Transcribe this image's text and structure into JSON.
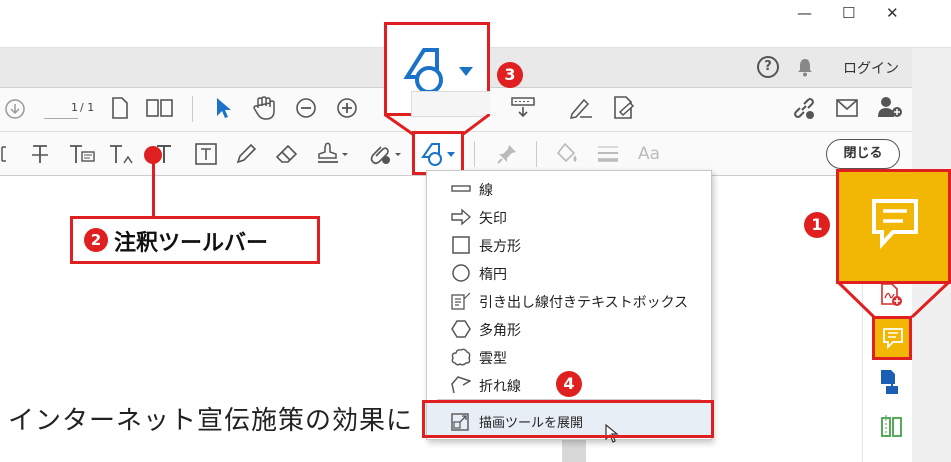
{
  "titlebar": {
    "minimize": "—",
    "maximize": "☐",
    "close": "✕"
  },
  "tabbar": {
    "help": "?",
    "login": "ログイン"
  },
  "main_toolbar": {
    "page_current": "1",
    "page_total": "/ 1"
  },
  "comment_toolbar": {
    "close_label": "閉じる",
    "font_label": "Aa"
  },
  "dropdown": {
    "items": [
      {
        "label": "線",
        "icon": "line-icon"
      },
      {
        "label": "矢印",
        "icon": "arrow-icon"
      },
      {
        "label": "長方形",
        "icon": "rectangle-icon"
      },
      {
        "label": "楕円",
        "icon": "ellipse-icon"
      },
      {
        "label": "引き出し線付きテキストボックス",
        "icon": "callout-textbox-icon"
      },
      {
        "label": "多角形",
        "icon": "polygon-icon"
      },
      {
        "label": "雲型",
        "icon": "cloud-icon"
      },
      {
        "label": "折れ線",
        "icon": "polyline-icon"
      }
    ],
    "expand_label": "描画ツールを展開"
  },
  "document": {
    "text": "インターネット宣伝施策の効果に"
  },
  "callouts": {
    "badge1": "1",
    "badge2": "2",
    "badge3": "3",
    "badge4": "4",
    "label2": "注釈ツールバー"
  },
  "colors": {
    "accent_red": "#e02020",
    "comment_yellow": "#f2b705",
    "tool_blue": "#1a73c8"
  }
}
